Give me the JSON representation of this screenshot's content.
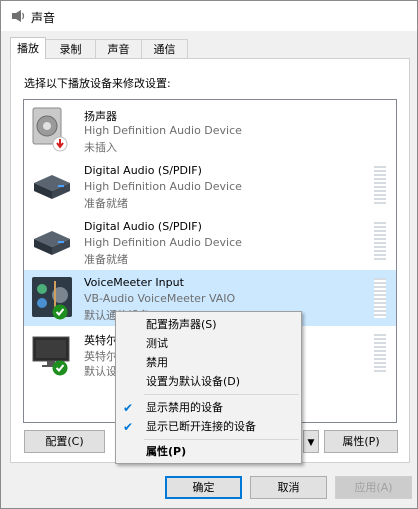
{
  "window": {
    "title": "声音"
  },
  "tabs": [
    "播放",
    "录制",
    "声音",
    "通信"
  ],
  "instruction": "选择以下播放设备来修改设置:",
  "devices": [
    {
      "name": "扬声器",
      "desc": "High Definition Audio Device",
      "status": "未插入"
    },
    {
      "name": "Digital Audio (S/PDIF)",
      "desc": "High Definition Audio Device",
      "status": "准备就绪"
    },
    {
      "name": "Digital Audio (S/PDIF)",
      "desc": "High Definition Audio Device",
      "status": "准备就绪"
    },
    {
      "name": "VoiceMeeter Input",
      "desc": "VB-Audio VoiceMeeter VAIO",
      "status": "默认通信设备"
    },
    {
      "name": "英特尔",
      "desc": "英特尔",
      "status": "默认设"
    }
  ],
  "buttons": {
    "configure": "配置(C)",
    "properties": "属性(P)",
    "ok": "确定",
    "cancel": "取消",
    "apply": "应用(A)"
  },
  "context_menu": {
    "items": [
      "配置扬声器(S)",
      "测试",
      "禁用",
      "设置为默认设备(D)"
    ],
    "checked_items": [
      "显示禁用的设备",
      "显示已断开连接的设备"
    ],
    "properties": "属性(P)"
  },
  "colors": {
    "selection": "#cce8ff",
    "accent": "#0078d7",
    "status_ok": "#1e8e1e",
    "status_err": "#d32020"
  },
  "icons": [
    "speaker-icon",
    "error-icon",
    "digital-audio-icon",
    "voicemeeter-icon",
    "default-check-icon",
    "phone-icon",
    "monitor-icon",
    "checkmark-icon"
  ]
}
